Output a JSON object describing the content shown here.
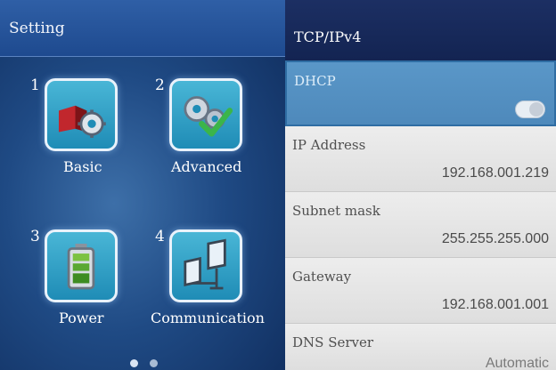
{
  "left_panel": {
    "title": "Setting",
    "items": [
      {
        "number": "1",
        "label": "Basic",
        "icon": "basic-settings-icon"
      },
      {
        "number": "2",
        "label": "Advanced",
        "icon": "advanced-settings-icon"
      },
      {
        "number": "3",
        "label": "Power",
        "icon": "battery-icon"
      },
      {
        "number": "4",
        "label": "Communication",
        "icon": "network-icon"
      }
    ],
    "pager": {
      "pages": 2,
      "current": 1
    }
  },
  "right_panel": {
    "title": "TCP/IPv4",
    "rows": [
      {
        "label": "DHCP",
        "type": "toggle",
        "enabled": false,
        "selected": true
      },
      {
        "label": "IP Address",
        "value": "192.168.001.219"
      },
      {
        "label": "Subnet mask",
        "value": "255.255.255.000"
      },
      {
        "label": "Gateway",
        "value": "192.168.001.001"
      },
      {
        "label": "DNS Server",
        "value": "Automatic"
      }
    ]
  },
  "colors": {
    "left_background": "#1f4a84",
    "right_header": "#1c2f63",
    "selected_row": "#5a97c8",
    "row_background": "#e7e7e7"
  }
}
